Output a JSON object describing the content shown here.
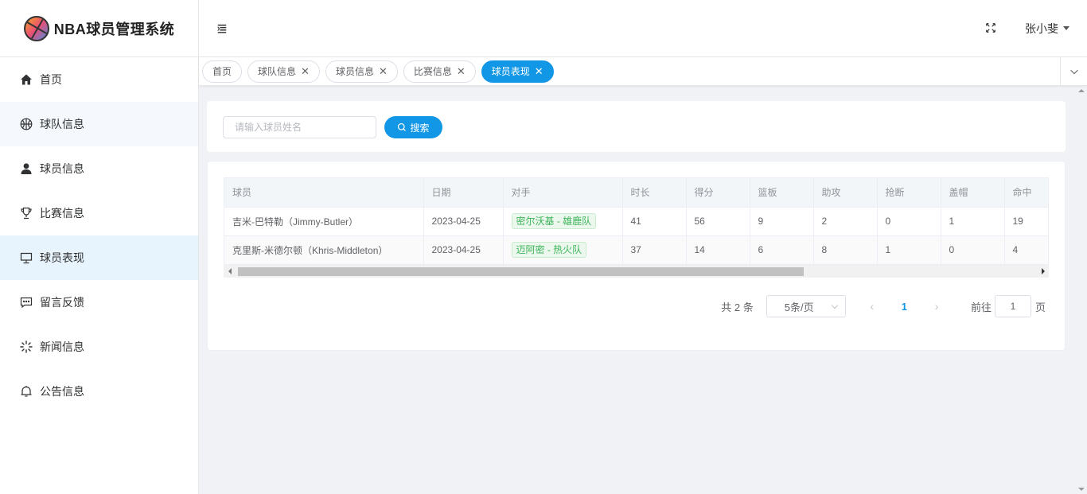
{
  "app": {
    "title": "NBA球员管理系统"
  },
  "sidebar": {
    "items": [
      {
        "label": "首页",
        "icon": "home-icon"
      },
      {
        "label": "球队信息",
        "icon": "basketball-icon"
      },
      {
        "label": "球员信息",
        "icon": "user-icon"
      },
      {
        "label": "比赛信息",
        "icon": "trophy-icon"
      },
      {
        "label": "球员表现",
        "icon": "monitor-icon",
        "active": true
      },
      {
        "label": "留言反馈",
        "icon": "chat-icon"
      },
      {
        "label": "新闻信息",
        "icon": "loading-icon"
      },
      {
        "label": "公告信息",
        "icon": "bell-icon"
      }
    ]
  },
  "header": {
    "user": "张小斐"
  },
  "tags": [
    {
      "label": "首页"
    },
    {
      "label": "球队信息"
    },
    {
      "label": "球员信息"
    },
    {
      "label": "比赛信息"
    },
    {
      "label": "球员表现",
      "active": true
    }
  ],
  "search": {
    "placeholder": "请输入球员姓名",
    "button": "搜索"
  },
  "table": {
    "columns": [
      "球员",
      "日期",
      "对手",
      "时长",
      "得分",
      "篮板",
      "助攻",
      "抢断",
      "盖帽",
      "命中"
    ],
    "rows": [
      [
        "吉米-巴特勒（Jimmy-Butler）",
        "2023-04-25",
        "密尔沃基 - 雄鹿队",
        "41",
        "56",
        "9",
        "2",
        "0",
        "1",
        "19"
      ],
      [
        "克里斯-米德尔顿（Khris-Middleton）",
        "2023-04-25",
        "迈阿密 - 热火队",
        "37",
        "14",
        "6",
        "8",
        "1",
        "0",
        "4"
      ]
    ]
  },
  "pagination": {
    "total": "共 2 条",
    "page_size": "5条/页",
    "current_page": "1",
    "goto_label": "前往",
    "goto_value": "1",
    "page_suffix": "页"
  },
  "colors": {
    "primary": "#1296e6",
    "tag_green": "#3bb558"
  }
}
